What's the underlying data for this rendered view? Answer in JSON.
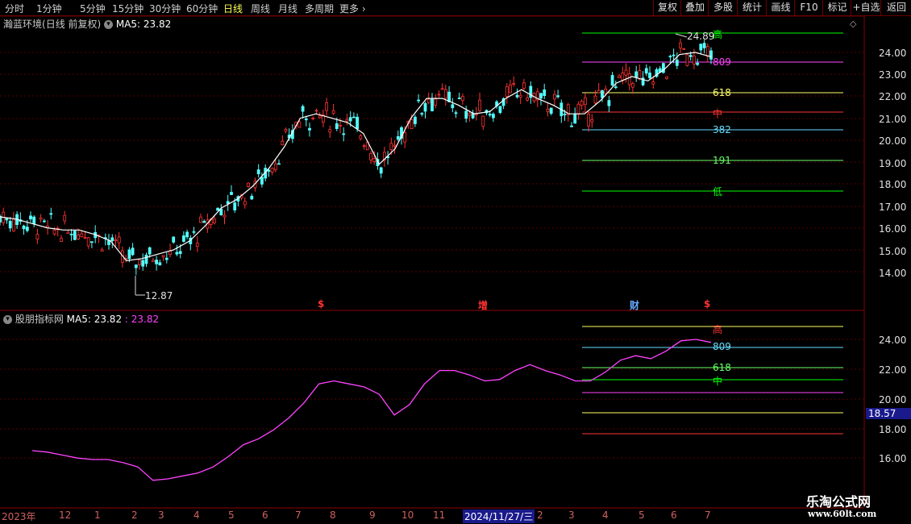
{
  "toolbar": {
    "periods": [
      "分时",
      "1分钟",
      "5分钟",
      "15分钟",
      "30分钟",
      "60分钟",
      "日线",
      "周线",
      "月线",
      "多周期",
      "更多"
    ],
    "active_period": "日线",
    "right_buttons": [
      "复权",
      "叠加",
      "多股",
      "统计",
      "画线",
      "F10",
      "标记",
      "+自选",
      "返回"
    ]
  },
  "main_panel": {
    "stock_name": "瀚蓝环境",
    "mode": "(日线 前复权)",
    "ma_label": "MA5: 23.82",
    "high_label": "24.89",
    "low_label": "12.87",
    "price_axis": [
      "24.00",
      "23.00",
      "22.00",
      "21.00",
      "20.00",
      "19.00",
      "18.00",
      "17.00",
      "16.00",
      "15.00",
      "14.00"
    ],
    "fib_labels": [
      "高",
      "809",
      "618",
      "中",
      "382",
      "191",
      "低"
    ],
    "fib_colors": [
      "#00ff00",
      "#ff44ff",
      "#ffff66",
      "#ff3333",
      "#66ddff",
      "#66ff66",
      "#00ff00"
    ],
    "markers": [
      "$",
      "增",
      "财",
      "$"
    ]
  },
  "sub_panel": {
    "title": "股朋指标网",
    "ma_label": "MA5: 23.82",
    "ma_value": ": 23.82",
    "axis": [
      "24.00",
      "22.00",
      "20.00",
      "18.00",
      "16.00"
    ],
    "current_value": "18.57",
    "fib_labels": [
      "高",
      "809",
      "618",
      "中"
    ],
    "fib_colors": [
      "#ff3333",
      "#66ddff",
      "#66ff66",
      "#00ff00"
    ]
  },
  "time_axis": {
    "labels": [
      "2023年",
      "12",
      "1",
      "2",
      "3",
      "4",
      "5",
      "6",
      "7",
      "8",
      "9",
      "10",
      "11",
      "2024/11/27/三",
      "2",
      "3",
      "4",
      "5",
      "6",
      "7"
    ]
  },
  "chart_data": {
    "type": "candlestick",
    "title": "瀚蓝环境 (日线 前复权)",
    "ylim": [
      13.2,
      25.2
    ],
    "ma5": [
      16.5,
      16.4,
      16.2,
      16.0,
      15.9,
      15.9,
      15.7,
      15.4,
      14.5,
      14.6,
      14.8,
      15.0,
      15.4,
      16.1,
      16.9,
      17.3,
      17.9,
      18.7,
      19.7,
      21.0,
      21.2,
      21.0,
      20.8,
      20.3,
      18.9,
      19.6,
      21.0,
      21.9,
      21.9,
      21.6,
      21.2,
      21.3,
      21.9,
      22.3,
      21.9,
      21.6,
      21.2,
      21.2,
      21.8,
      22.6,
      22.9,
      22.7,
      23.2,
      23.9,
      24.0,
      23.8
    ],
    "high": 24.89,
    "low": 12.87
  }
}
